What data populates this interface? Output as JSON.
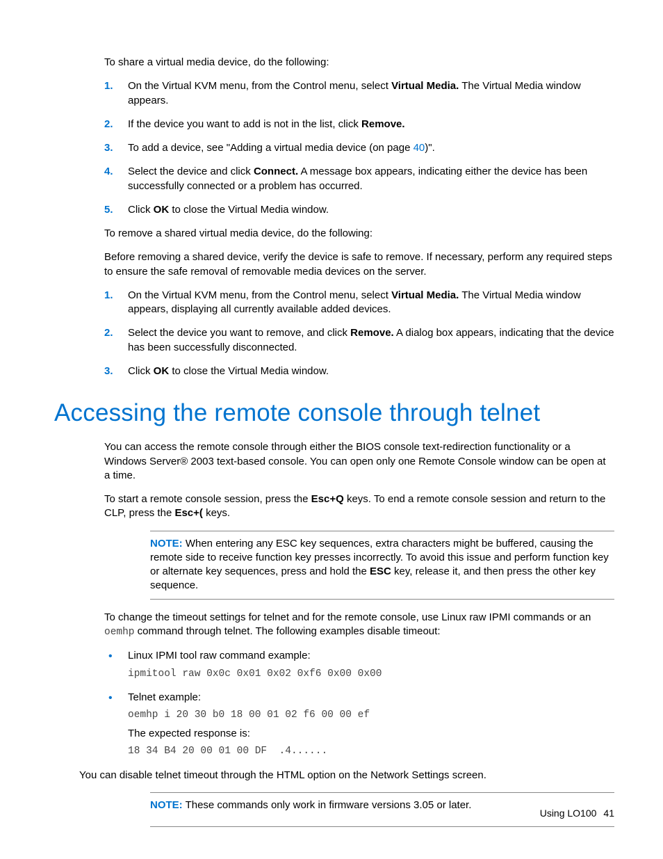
{
  "intro_share": "To share a virtual media device, do the following:",
  "share_steps": [
    {
      "pre": "On the Virtual KVM menu, from the Control menu, select ",
      "b1": "Virtual Media.",
      "post": " The Virtual Media window appears."
    },
    {
      "pre": "If the device you want to add is not in the list, click ",
      "b1": "Remove.",
      "post": ""
    },
    {
      "pre": "To add a device, see \"Adding a virtual media device (on page ",
      "link": "40",
      "post": ")\"."
    },
    {
      "pre": "Select the device and click ",
      "b1": "Connect.",
      "post": " A message box appears, indicating either the device has been successfully connected or a problem has occurred."
    },
    {
      "pre": "Click ",
      "b1": "OK",
      "post": " to close the Virtual Media window."
    }
  ],
  "intro_remove": "To remove a shared virtual media device, do the following:",
  "remove_warning": "Before removing a shared device, verify the device is safe to remove. If necessary, perform any required steps to ensure the safe removal of removable media devices on the server.",
  "remove_steps": [
    {
      "pre": "On the Virtual KVM menu, from the Control menu, select ",
      "b1": "Virtual Media.",
      "post": " The Virtual Media window appears, displaying all currently available added devices."
    },
    {
      "pre": "Select the device you want to remove, and click ",
      "b1": "Remove.",
      "post": " A dialog box appears, indicating that the device has been successfully disconnected."
    },
    {
      "pre": "Click ",
      "b1": "OK",
      "post": " to close the Virtual Media window."
    }
  ],
  "h1": "Accessing the remote console through telnet",
  "telnet_p1": "You can access the remote console through either the BIOS console text-redirection functionality or a Windows Server®  2003 text-based console. You can open only one Remote Console window can be open at a time.",
  "telnet_p2_a": "To start a remote console session, press the ",
  "telnet_p2_b1": "Esc+Q",
  "telnet_p2_b": " keys. To end a remote console session and return to the CLP, press the ",
  "telnet_p2_b2": "Esc+(",
  "telnet_p2_c": " keys.",
  "note1_label": "NOTE:",
  "note1_a": "  When entering any ESC key sequences, extra characters might be buffered, causing the remote side to receive function key presses incorrectly. To avoid this issue and perform function key or alternate key sequences, press and hold the ",
  "note1_b": "ESC",
  "note1_c": " key, release it, and then press the other key sequence.",
  "timeout_p_a": "To change the timeout settings for telnet and for the remote console, use Linux raw IPMI commands or an ",
  "timeout_code": "oemhp",
  "timeout_p_b": " command through telnet. The following examples disable timeout:",
  "bullets": [
    {
      "label": "Linux IPMI tool raw command example:",
      "code": "ipmitool raw 0x0c 0x01 0x02 0xf6 0x00 0x00"
    },
    {
      "label": "Telnet example:",
      "code": "oemhp i 20 30 b0 18 00 01 02 f6 00 00 ef",
      "resp_label": "The expected response is:",
      "resp_code": "18 34 B4 20 00 01 00 DF  .4......"
    }
  ],
  "disable_html": "You can disable telnet timeout through the HTML option on the Network Settings screen.",
  "note2_label": "NOTE:",
  "note2_text": "  These commands only work in firmware versions 3.05 or later.",
  "footer_text": "Using LO100",
  "footer_page": "41"
}
